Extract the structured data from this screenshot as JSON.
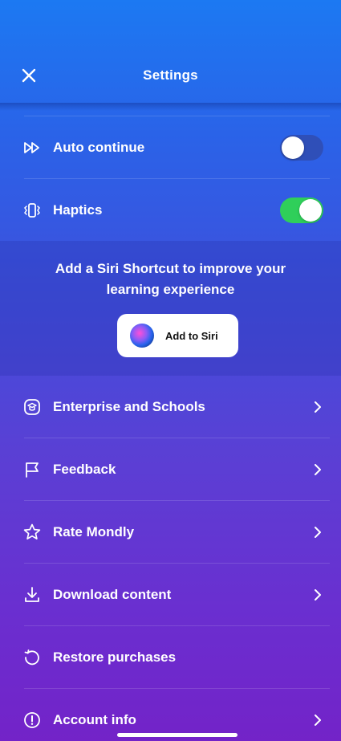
{
  "header": {
    "title": "Settings",
    "close_icon": "close-icon"
  },
  "toggles": [
    {
      "label": "Auto continue",
      "icon": "fast-forward-icon",
      "state": "off"
    },
    {
      "label": "Haptics",
      "icon": "vibration-icon",
      "state": "on"
    }
  ],
  "siri": {
    "text": "Add a Siri Shortcut to improve your learning experience",
    "button_label": "Add to Siri",
    "icon": "siri-icon"
  },
  "menu": [
    {
      "label": "Enterprise and Schools",
      "icon": "school-icon",
      "chevron": true
    },
    {
      "label": "Feedback",
      "icon": "flag-icon",
      "chevron": true
    },
    {
      "label": "Rate Mondly",
      "icon": "star-icon",
      "chevron": true
    },
    {
      "label": "Download content",
      "icon": "download-icon",
      "chevron": true
    },
    {
      "label": "Restore purchases",
      "icon": "restore-icon",
      "chevron": false
    },
    {
      "label": "Account info",
      "icon": "info-icon",
      "chevron": true
    }
  ],
  "colors": {
    "gradient_top": "#1c79f2",
    "gradient_bottom": "#7323c8",
    "toggle_on": "#2fcf5a",
    "toggle_off": "#2f4fb8"
  }
}
